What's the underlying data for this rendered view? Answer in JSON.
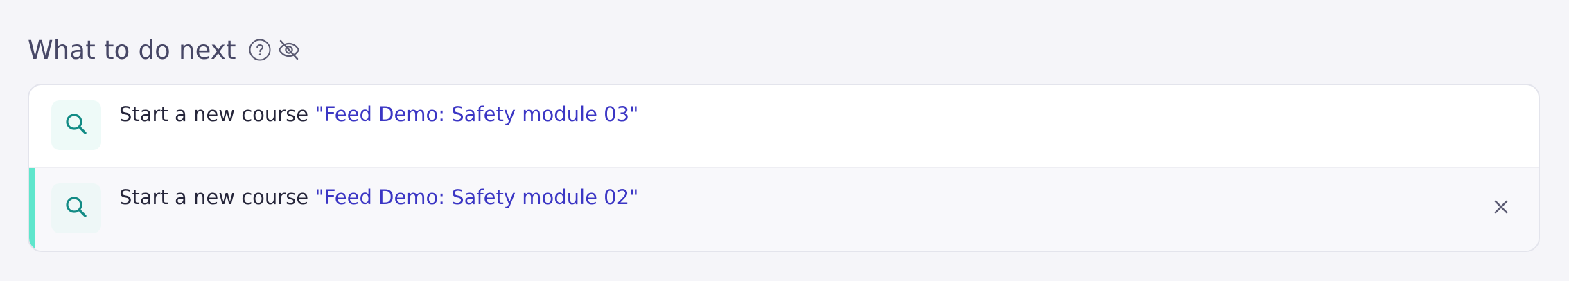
{
  "header": {
    "title": "What to do next",
    "help_icon": "question-circle-icon",
    "hide_icon": "eye-slash-icon"
  },
  "suggestions": [
    {
      "icon": "search-icon",
      "prefix": "Start a new course",
      "course": "\"Feed Demo: Safety module 03\"",
      "active": false,
      "dismissible": false
    },
    {
      "icon": "search-icon",
      "prefix": "Start a new course",
      "course": "\"Feed Demo: Safety module 02\"",
      "active": true,
      "dismissible": true
    }
  ],
  "colors": {
    "background": "#f5f5f9",
    "title": "#474766",
    "link": "#3b36c4",
    "icon_teal": "#128b85",
    "accent": "#5fe6cc"
  }
}
